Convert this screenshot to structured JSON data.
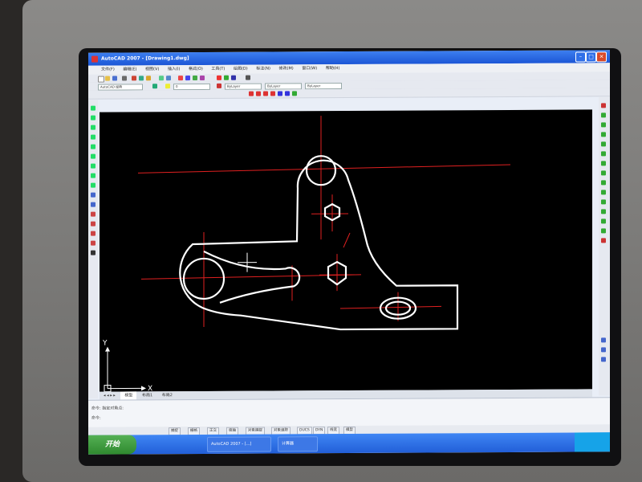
{
  "window": {
    "title": "AutoCAD 2007 - [Drawing1.dwg]"
  },
  "menu": [
    "文件(F)",
    "编辑(E)",
    "视图(V)",
    "插入(I)",
    "格式(O)",
    "工具(T)",
    "绘图(D)",
    "标注(N)",
    "修改(M)",
    "窗口(W)",
    "帮助(H)"
  ],
  "toolbar": {
    "workspace_value": "AutoCAD 经典"
  },
  "drawing": {
    "ucs_y": "Y",
    "ucs_x": "X",
    "colors": {
      "outline": "#ffffff",
      "centerline": "#e02020",
      "background": "#000000"
    }
  },
  "tabs": [
    "模型",
    "布局1",
    "布局2"
  ],
  "command": {
    "line1": "命令: 指定对角点:",
    "line2": "命令:"
  },
  "status": [
    "捕捉",
    "栅格",
    "正交",
    "极轴",
    "对象捕捉",
    "对象追踪",
    "DUCS",
    "DYN",
    "线宽",
    "模型"
  ],
  "taskbar": {
    "start_label": "开始",
    "item1": "AutoCAD 2007 - [...]",
    "item2": "计算器"
  }
}
